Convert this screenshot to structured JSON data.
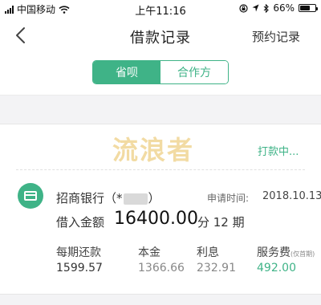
{
  "status_bar": {
    "carrier": "中国移动",
    "time": "上午11:16",
    "battery_text": "66%",
    "battery_level": 0.66,
    "icons": [
      "signal-icon",
      "wifi-icon",
      "lock-rotation-icon",
      "location-icon",
      "bluetooth-icon",
      "battery-icon"
    ]
  },
  "nav": {
    "back_icon": "chevron-left-icon",
    "title": "借款记录",
    "right_action": "预约记录"
  },
  "segments": [
    {
      "label": "省呗",
      "active": true
    },
    {
      "label": "合作方",
      "active": false
    }
  ],
  "record": {
    "watermark": "流浪者",
    "status": "打款中...",
    "bank_icon": "bank-card-icon",
    "bank_name_prefix": "招商银行（*",
    "bank_name_suffix": "）",
    "apply_time_label": "申请时间:",
    "apply_time": "2018.10.13",
    "borrow_label": "借入金额",
    "borrow_amount": "16400.00",
    "borrow_period": "分 12 期",
    "columns": [
      {
        "label": "每期还款",
        "value": "1599.57"
      },
      {
        "label": "本金",
        "value": "1366.66"
      },
      {
        "label": "利息",
        "value": "232.91"
      },
      {
        "label": "服务费",
        "note": "(仅首期)",
        "value": "492.00"
      }
    ]
  },
  "colors": {
    "accent": "#3fb387",
    "watermark": "#f1d89a",
    "background_gray": "#f3f3f5"
  }
}
